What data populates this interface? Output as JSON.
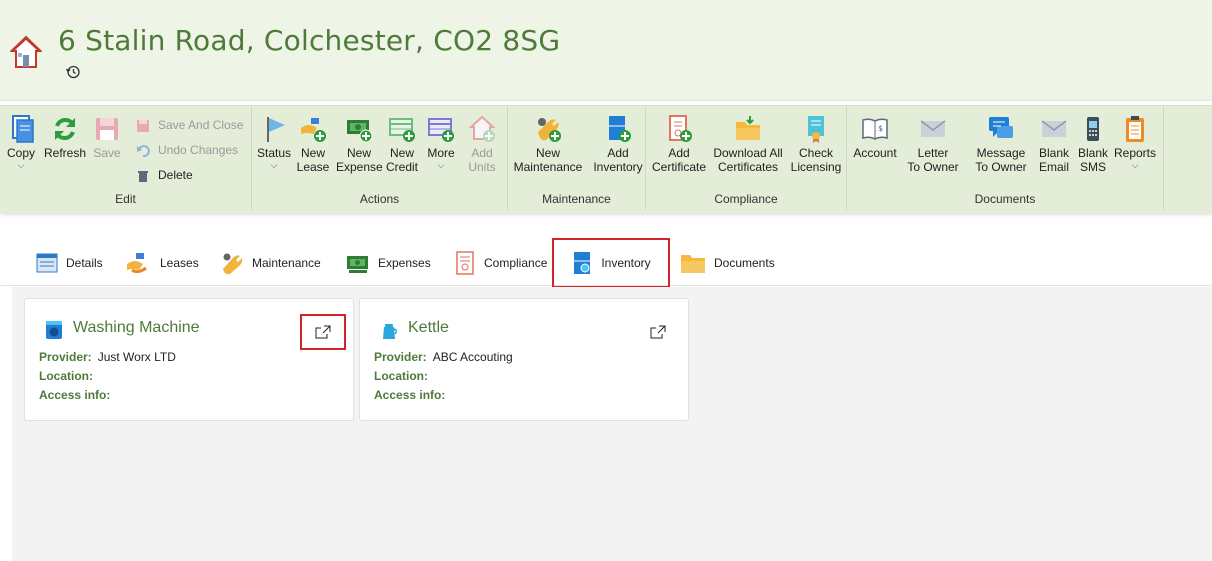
{
  "header": {
    "title": "6 Stalin Road, Colchester, CO2 8SG",
    "home_icon": "house-icon",
    "history_icon": "history-icon"
  },
  "ribbon": {
    "edit": {
      "label": "Edit",
      "copy": "Copy",
      "refresh": "Refresh",
      "save": "Save",
      "save_and_close": "Save And Close",
      "undo_changes": "Undo Changes",
      "delete": "Delete"
    },
    "actions": {
      "label": "Actions",
      "status": "Status",
      "new_lease": "New\nLease",
      "new_expense": "New\nExpense",
      "new_credit": "New\nCredit",
      "more": "More",
      "add_units": "Add\nUnits"
    },
    "maintenance": {
      "label": "Maintenance",
      "new_maintenance": "New\nMaintenance",
      "add_inventory": "Add\nInventory"
    },
    "compliance": {
      "label": "Compliance",
      "add_certificate": "Add\nCertificate",
      "download_all_certificates": "Download All\nCertificates",
      "check_licensing": "Check\nLicensing"
    },
    "documents": {
      "label": "Documents",
      "account": "Account",
      "letter_to_owner": "Letter\nTo Owner",
      "message_to_owner": "Message\nTo Owner",
      "blank_email": "Blank\nEmail",
      "blank_sms": "Blank\nSMS",
      "reports": "Reports"
    }
  },
  "tabs": [
    {
      "label": "Details",
      "icon": "details-icon"
    },
    {
      "label": "Leases",
      "icon": "leases-icon"
    },
    {
      "label": "Maintenance",
      "icon": "maintenance-icon"
    },
    {
      "label": "Expenses",
      "icon": "expenses-icon"
    },
    {
      "label": "Compliance",
      "icon": "compliance-icon"
    },
    {
      "label": "Inventory",
      "icon": "inventory-icon",
      "active": true
    },
    {
      "label": "Documents",
      "icon": "folder-icon"
    }
  ],
  "inventory": {
    "provider_label": "Provider:",
    "location_label": "Location:",
    "access_label": "Access info:",
    "items": [
      {
        "name": "Washing Machine",
        "icon": "washing-machine-icon",
        "provider": "Just Worx LTD",
        "location": "",
        "access_info": ""
      },
      {
        "name": "Kettle",
        "icon": "kettle-icon",
        "provider": "ABC Accouting",
        "location": "",
        "access_info": ""
      }
    ]
  },
  "colors": {
    "accent_green": "#4e7a3a",
    "header_bg": "#eef5e7",
    "ribbon_bg": "#e3edd8",
    "highlight_red": "#d3242c"
  }
}
